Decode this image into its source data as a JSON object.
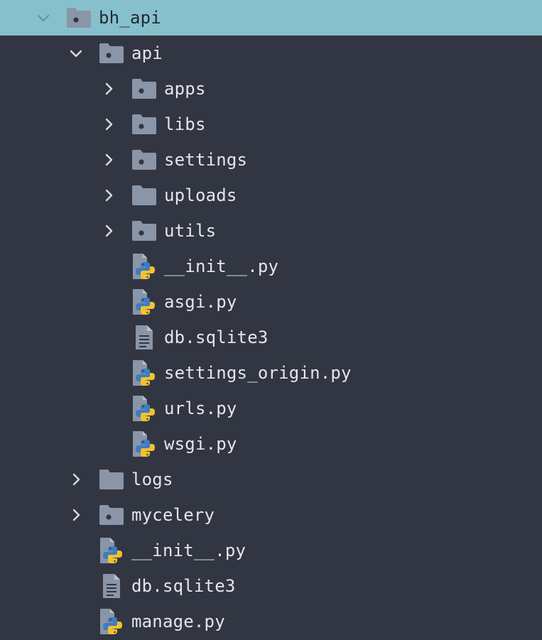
{
  "tree": {
    "root": {
      "label": "bh_api",
      "state": "expanded",
      "selected": true,
      "icon": "folder-module-icon"
    },
    "items": [
      {
        "label": "api",
        "type": "folder",
        "state": "expanded",
        "icon": "folder-module-icon",
        "depth": 1
      },
      {
        "label": "apps",
        "type": "folder",
        "state": "collapsed",
        "icon": "folder-module-icon",
        "depth": 2
      },
      {
        "label": "libs",
        "type": "folder",
        "state": "collapsed",
        "icon": "folder-module-icon",
        "depth": 2
      },
      {
        "label": "settings",
        "type": "folder",
        "state": "collapsed",
        "icon": "folder-module-icon",
        "depth": 2
      },
      {
        "label": "uploads",
        "type": "folder",
        "state": "collapsed",
        "icon": "folder-icon",
        "depth": 2
      },
      {
        "label": "utils",
        "type": "folder",
        "state": "collapsed",
        "icon": "folder-module-icon",
        "depth": 2
      },
      {
        "label": "__init__.py",
        "type": "file",
        "icon": "python-file-icon",
        "depth": 2
      },
      {
        "label": "asgi.py",
        "type": "file",
        "icon": "python-file-icon",
        "depth": 2
      },
      {
        "label": "db.sqlite3",
        "type": "file",
        "icon": "text-file-icon",
        "depth": 2
      },
      {
        "label": "settings_origin.py",
        "type": "file",
        "icon": "python-file-icon",
        "depth": 2
      },
      {
        "label": "urls.py",
        "type": "file",
        "icon": "python-file-icon",
        "depth": 2
      },
      {
        "label": "wsgi.py",
        "type": "file",
        "icon": "python-file-icon",
        "depth": 2
      },
      {
        "label": "logs",
        "type": "folder",
        "state": "collapsed",
        "icon": "folder-icon",
        "depth": 1
      },
      {
        "label": "mycelery",
        "type": "folder",
        "state": "collapsed",
        "icon": "folder-module-icon",
        "depth": 1
      },
      {
        "label": "__init__.py",
        "type": "file",
        "icon": "python-file-icon",
        "depth": 1
      },
      {
        "label": "db.sqlite3",
        "type": "file",
        "icon": "text-file-icon",
        "depth": 1
      },
      {
        "label": "manage.py",
        "type": "file",
        "icon": "python-file-icon",
        "depth": 1
      }
    ]
  },
  "colors": {
    "background": "#313642",
    "selected_row": "#87c0cd",
    "folder": "#8a95a8",
    "text": "#e3e6ec",
    "python_blue": "#3f7cc0",
    "python_yellow": "#f2c22e"
  }
}
